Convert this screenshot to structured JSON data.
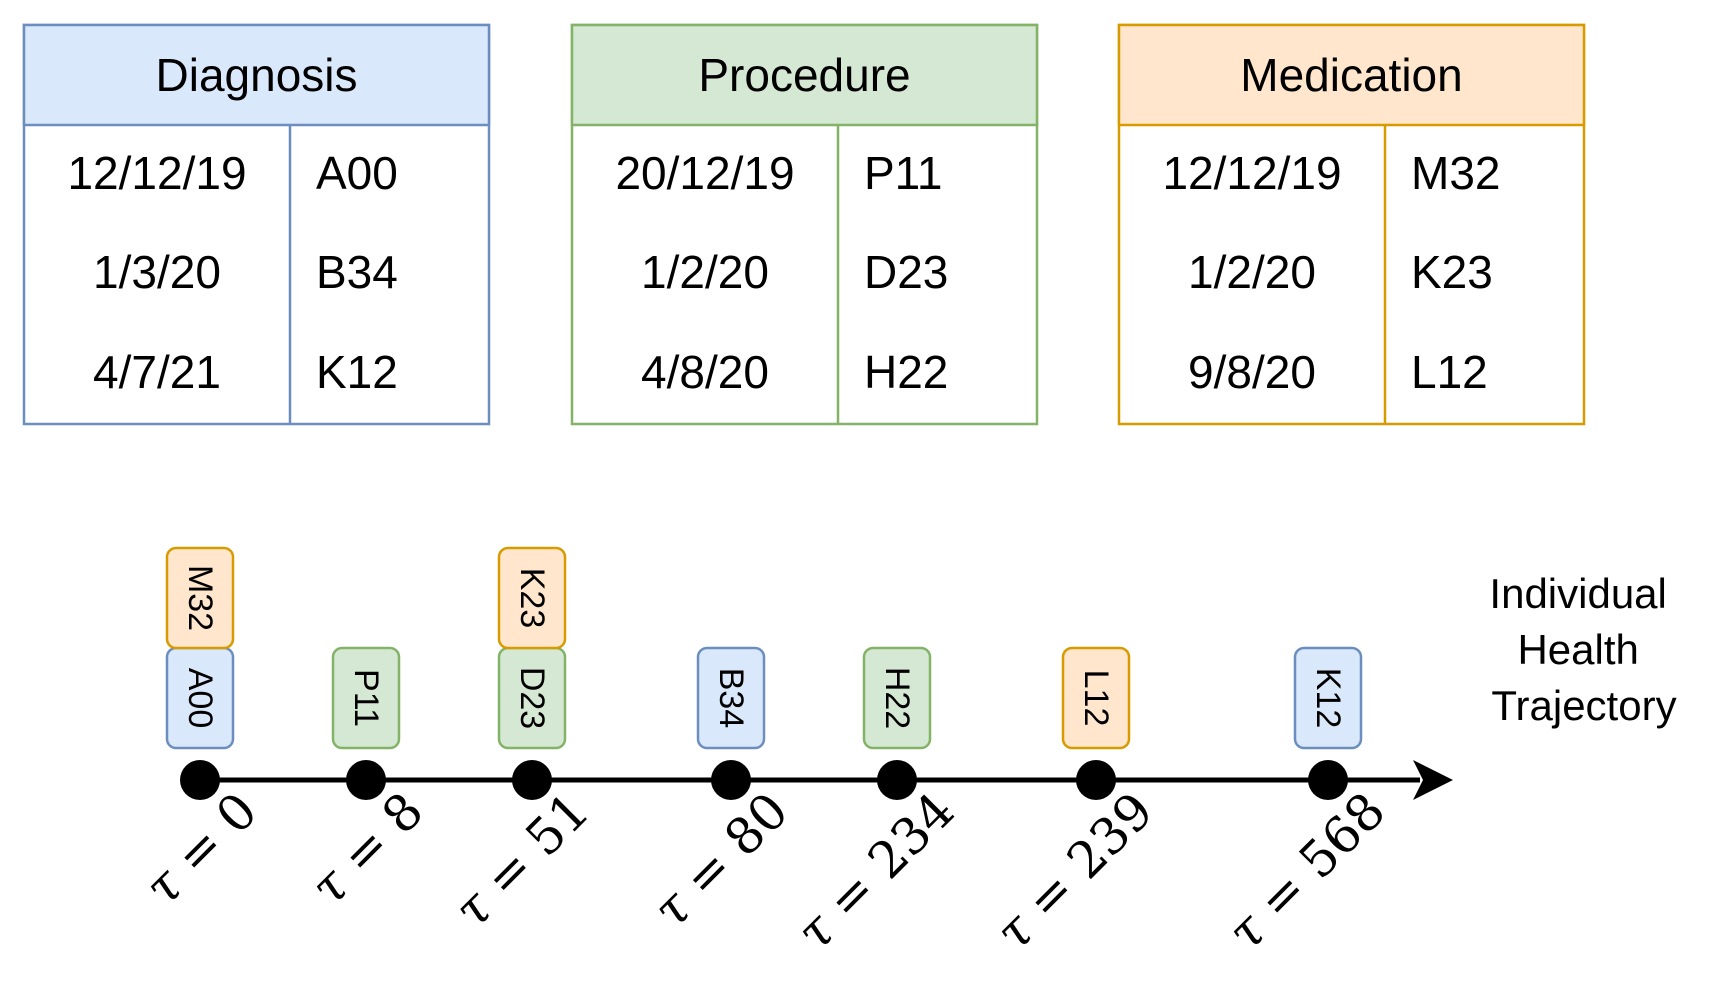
{
  "colors": {
    "diagnosis": {
      "fill": "#dae8fc",
      "stroke": "#6c8ebf"
    },
    "procedure": {
      "fill": "#d5e8d4",
      "stroke": "#82b366"
    },
    "medication": {
      "fill": "#ffe6cc",
      "stroke": "#d79b00"
    },
    "axis": "#000000"
  },
  "tables": [
    {
      "type": "diagnosis",
      "title": "Diagnosis",
      "rows": [
        [
          "12/12/19",
          "A00"
        ],
        [
          "1/3/20",
          "B34"
        ],
        [
          "4/7/21",
          "K12"
        ]
      ]
    },
    {
      "type": "procedure",
      "title": "Procedure",
      "rows": [
        [
          "20/12/19",
          "P11"
        ],
        [
          "1/2/20",
          "D23"
        ],
        [
          "4/8/20",
          "H22"
        ]
      ]
    },
    {
      "type": "medication",
      "title": "Medication",
      "rows": [
        [
          "12/12/19",
          "M32"
        ],
        [
          "1/2/20",
          "K23"
        ],
        [
          "9/8/20",
          "L12"
        ]
      ]
    }
  ],
  "timeline": {
    "title_lines": [
      "Individual",
      "Health",
      "Trajectory"
    ],
    "tau_symbol": "τ",
    "events": [
      {
        "tau": "0",
        "codes": [
          {
            "code": "A00",
            "type": "diagnosis"
          },
          {
            "code": "M32",
            "type": "medication"
          }
        ]
      },
      {
        "tau": "8",
        "codes": [
          {
            "code": "P11",
            "type": "procedure"
          }
        ]
      },
      {
        "tau": "51",
        "codes": [
          {
            "code": "D23",
            "type": "procedure"
          },
          {
            "code": "K23",
            "type": "medication"
          }
        ]
      },
      {
        "tau": "80",
        "codes": [
          {
            "code": "B34",
            "type": "diagnosis"
          }
        ]
      },
      {
        "tau": "234",
        "codes": [
          {
            "code": "H22",
            "type": "procedure"
          }
        ]
      },
      {
        "tau": "239",
        "codes": [
          {
            "code": "L12",
            "type": "medication"
          }
        ]
      },
      {
        "tau": "568",
        "codes": [
          {
            "code": "K12",
            "type": "diagnosis"
          }
        ]
      }
    ]
  }
}
